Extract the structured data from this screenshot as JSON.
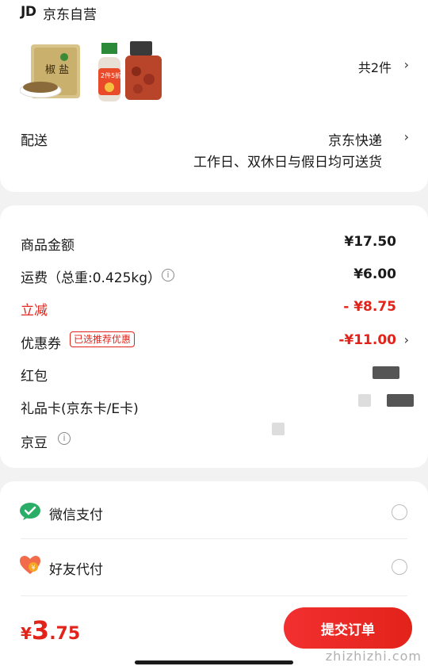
{
  "shop": {
    "logo": "JD",
    "name": "京东自营",
    "item_count": "共2件",
    "chevron": "›"
  },
  "delivery": {
    "label": "配送",
    "method": "京东快递",
    "note": "工作日、双休日与假日均可送货"
  },
  "price_rows": {
    "goods_amount": {
      "label": "商品金额",
      "value": "¥17.50"
    },
    "shipping": {
      "label": "运费（总重:0.425kg）",
      "value": "¥6.00"
    },
    "discount": {
      "label": "立减",
      "value": "- ¥8.75"
    },
    "coupon": {
      "label": "优惠券",
      "tag": "已选推荐优惠",
      "value": "-¥11.00"
    },
    "red_packet": {
      "label": "红包"
    },
    "gift_card": {
      "label": "礼品卡(京东卡/E卡)"
    },
    "jd_beans": {
      "label": "京豆"
    }
  },
  "payment": {
    "wechat": "微信支付",
    "friend": "好友代付"
  },
  "footer": {
    "currency": "¥",
    "total_int": "3",
    "total_dec": ".75",
    "submit": "提交订单"
  },
  "watermark": "zhizhizhi.com",
  "colors": {
    "accent": "#e2231a",
    "wechat": "#2aae67"
  },
  "icons": [
    "info-icon",
    "chevron-right-icon",
    "wechat-pay-icon",
    "friend-pay-icon",
    "radio-icon"
  ]
}
